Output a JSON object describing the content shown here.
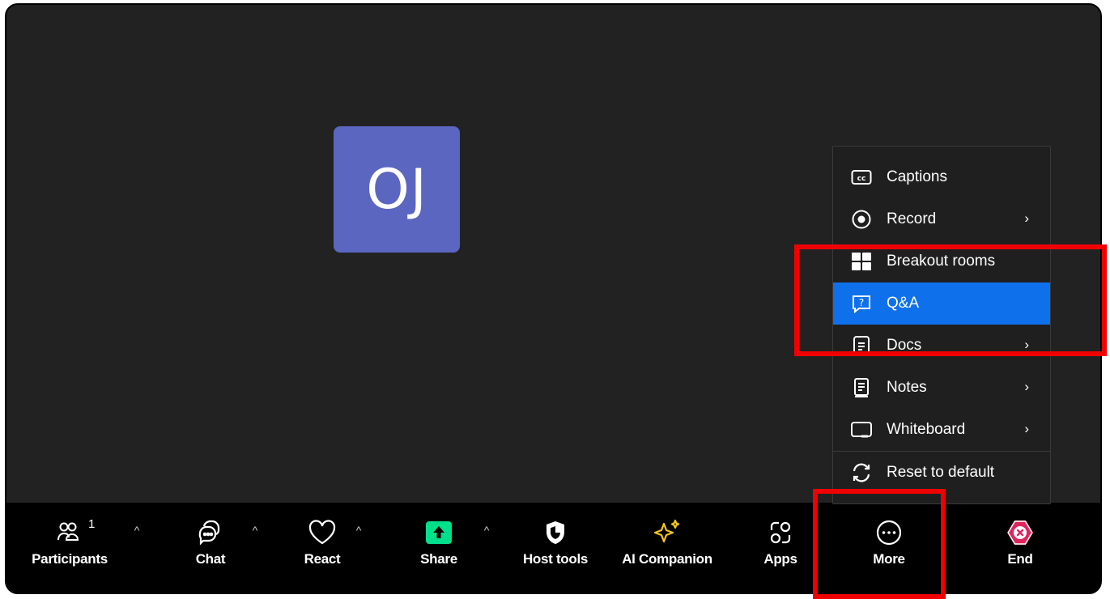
{
  "video": {
    "initials": "OJ",
    "avatar_color": "#5b66c1"
  },
  "toolbar": {
    "participants": {
      "label": "Participants",
      "count": "1"
    },
    "chat": {
      "label": "Chat"
    },
    "react": {
      "label": "React"
    },
    "share": {
      "label": "Share",
      "accent": "#00e08a"
    },
    "host_tools": {
      "label": "Host tools"
    },
    "ai_companion": {
      "label": "AI Companion",
      "accent": "#f5c518"
    },
    "apps": {
      "label": "Apps"
    },
    "more": {
      "label": "More"
    },
    "end": {
      "label": "End",
      "accent": "#e0245e"
    }
  },
  "more_menu": {
    "items": [
      {
        "label": "Captions",
        "icon": "captions-icon"
      },
      {
        "label": "Record",
        "icon": "record-icon",
        "submenu": true
      },
      {
        "label": "Breakout rooms",
        "icon": "breakout-rooms-icon"
      },
      {
        "label": "Q&A",
        "icon": "qa-icon",
        "selected": true
      },
      {
        "label": "Docs",
        "icon": "docs-icon",
        "submenu": true
      },
      {
        "label": "Notes",
        "icon": "notes-icon",
        "submenu": true
      },
      {
        "label": "Whiteboard",
        "icon": "whiteboard-icon",
        "submenu": true
      },
      {
        "label": "Reset to default",
        "icon": "reset-icon"
      }
    ],
    "selected_color": "#0e71eb"
  },
  "annotation_color": "#f00000"
}
